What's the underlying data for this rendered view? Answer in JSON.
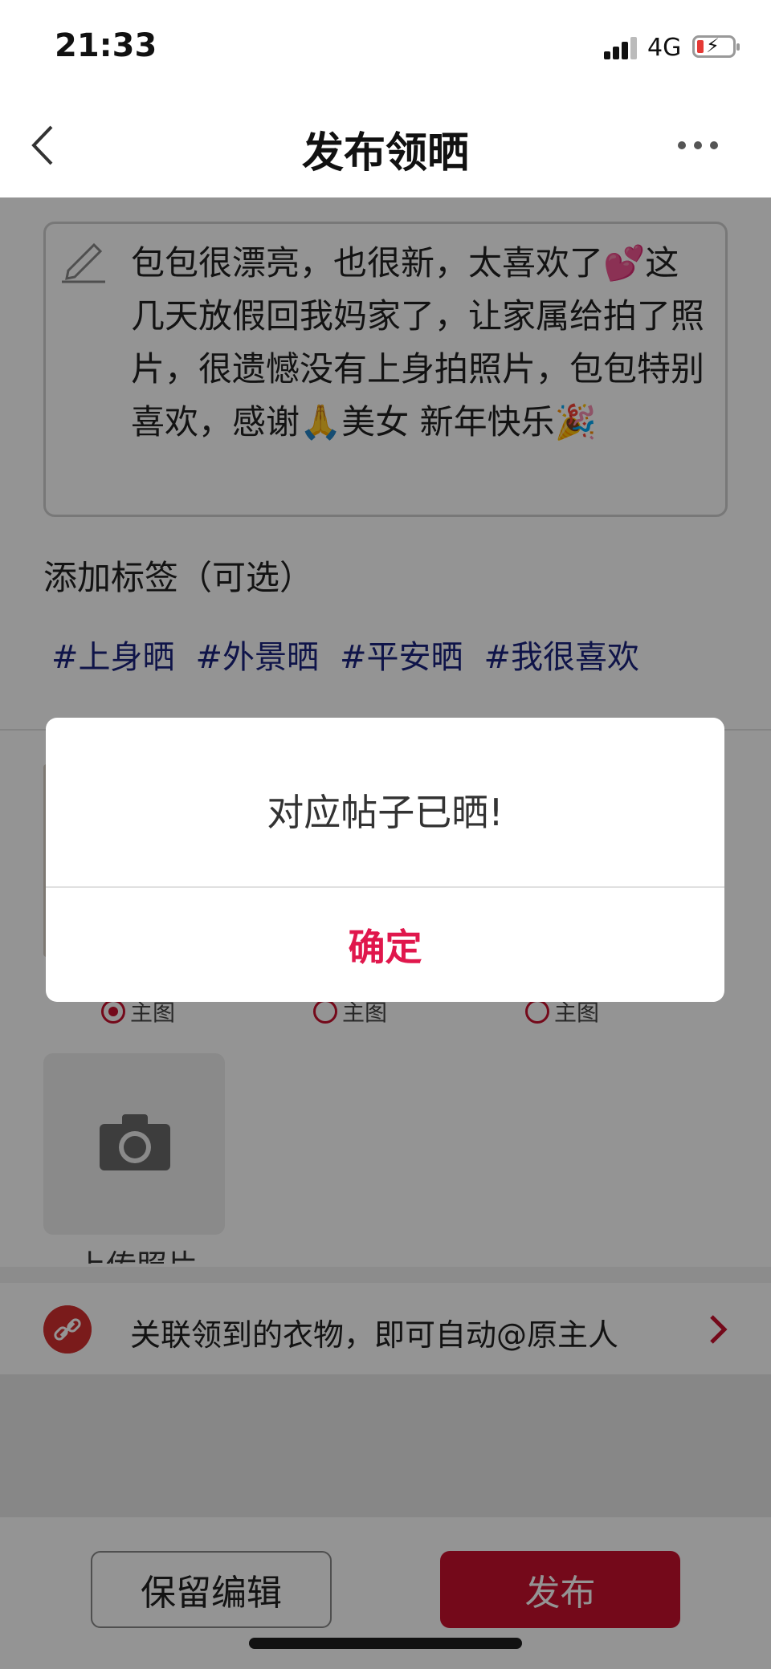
{
  "status_bar": {
    "time": "21:33",
    "network": "4G",
    "battery_level": 0.15
  },
  "nav": {
    "title": "发布领晒",
    "back_icon": "chevron-left-icon",
    "more_icon": "more-dots-icon"
  },
  "post": {
    "text": "包包很漂亮，也很新，太喜欢了💕这几天放假回我妈家了，让家属给拍了照片，很遗憾没有上身拍照片，包包特别喜欢，感谢🙏美女 新年快乐🎉",
    "edit_icon": "pencil-icon"
  },
  "tags": {
    "heading": "添加标签（可选）",
    "items": [
      "#上身晒",
      "#外景晒",
      "#平安晒",
      "#我很喜欢"
    ]
  },
  "photos": {
    "main_label": "主图",
    "selected_index": 0,
    "upload_label": "上传照片"
  },
  "link_bar": {
    "text": "关联领到的衣物，即可自动@原主人",
    "icon": "link-icon"
  },
  "bottom": {
    "keep_label": "保留编辑",
    "publish_label": "发布"
  },
  "dialog": {
    "message": "对应帖子已晒!",
    "confirm_label": "确定"
  },
  "colors": {
    "accent": "#c8102e",
    "tag": "#1a237e",
    "confirm": "#e0174c"
  }
}
